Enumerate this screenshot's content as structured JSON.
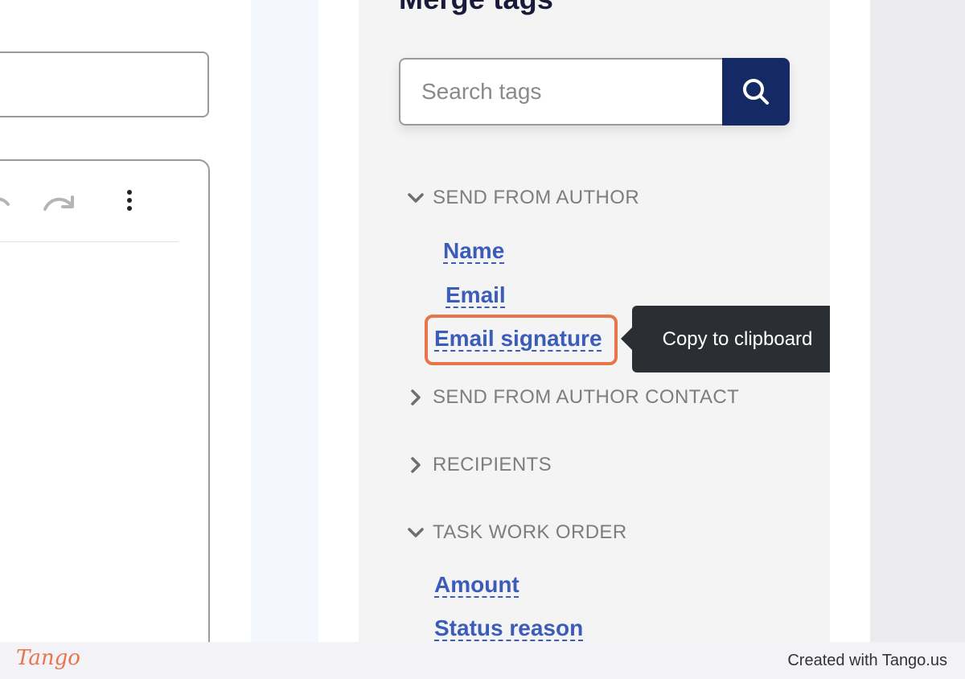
{
  "panel": {
    "title": "Merge tags",
    "search": {
      "placeholder": "Search tags",
      "value": ""
    },
    "sections": [
      {
        "label": "SEND FROM AUTHOR",
        "expanded": true,
        "tags": [
          "Name",
          "Email",
          "Email signature"
        ]
      },
      {
        "label": "SEND FROM AUTHOR CONTACT",
        "expanded": false
      },
      {
        "label": "RECIPIENTS",
        "expanded": false
      },
      {
        "label": "TASK WORK ORDER",
        "expanded": true,
        "tags": [
          "Amount",
          "Status reason"
        ]
      }
    ],
    "tooltip": "Copy to clipboard"
  },
  "footer": {
    "logo": "Tango",
    "credit": "Created with Tango.us"
  },
  "colors": {
    "accent_navy": "#152a64",
    "link_blue": "#3b5cb8",
    "highlight_orange": "#e8744a",
    "tooltip_bg": "#2b2e33"
  }
}
